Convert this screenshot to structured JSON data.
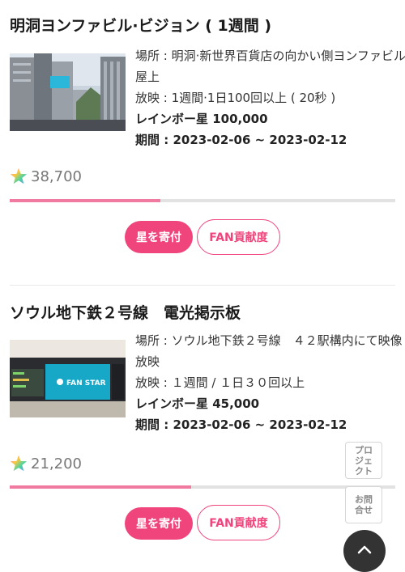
{
  "accent_color": "#f0447c",
  "star_icon": "rainbow-star-icon",
  "cards": [
    {
      "title": "明洞ヨンファビル·ビジョン ( 1週間 )",
      "location_line1": "場所 : 明洞·新世界百貨店の向かい側ヨンファビル",
      "location_line2": "屋上",
      "screening": "放映 : 1週間·1日100回以上 ( 20秒 )",
      "rainbow_star": "レインボー星 100,000",
      "period": "期間 : 2023-02-06 ~ 2023-02-12",
      "star_count": "38,700",
      "progress": 0.39,
      "donate_label": "星を寄付",
      "fan_label": "FAN貢献度"
    },
    {
      "title": "ソウル地下鉄２号線　電光掲示板",
      "location_line1": "場所 : ソウル地下鉄２号線　４２駅構内にて映像",
      "location_line2": "放映",
      "screening": "放映 : １週間 /  １日３０回以上",
      "rainbow_star": "レインボー星 45,000",
      "period": "期間 : 2023-02-06 ~ 2023-02-12",
      "star_count": "21,200",
      "progress": 0.47,
      "donate_label": "星を寄付",
      "fan_label": "FAN貢献度",
      "screen_text": "FAN STAR"
    }
  ],
  "side": {
    "project_label": "プロジェクト",
    "contact_label": "お問合せ"
  }
}
